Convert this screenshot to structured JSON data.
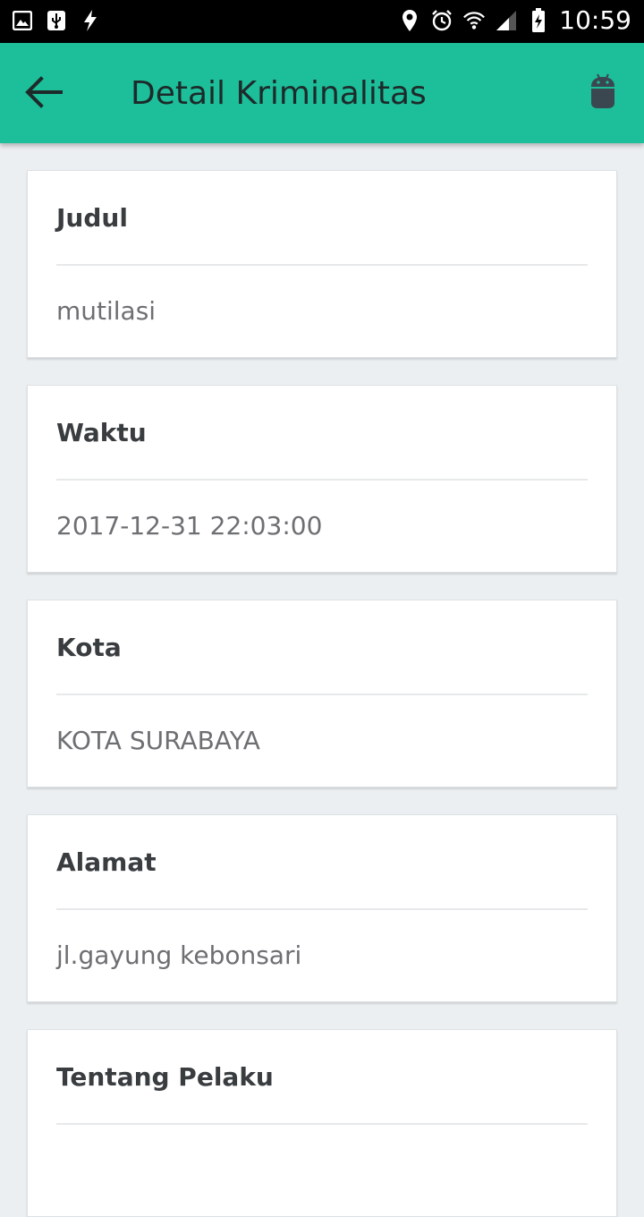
{
  "status_bar": {
    "time": "10:59",
    "left_icons": [
      "image-icon",
      "usb-icon",
      "flash-icon"
    ],
    "right_icons": [
      "location-icon",
      "alarm-icon",
      "wifi-icon",
      "signal-icon",
      "battery-icon"
    ]
  },
  "app_bar": {
    "title": "Detail Kriminalitas",
    "background": "#1dbe9a",
    "back_icon": "arrow-back-icon",
    "action_icon": "android-icon"
  },
  "cards": [
    {
      "label": "Judul",
      "value": "mutilasi"
    },
    {
      "label": "Waktu",
      "value": "2017-12-31 22:03:00"
    },
    {
      "label": "Kota",
      "value": "KOTA SURABAYA"
    },
    {
      "label": "Alamat",
      "value": "jl.gayung kebonsari"
    },
    {
      "label": "Tentang Pelaku",
      "value": ""
    }
  ]
}
